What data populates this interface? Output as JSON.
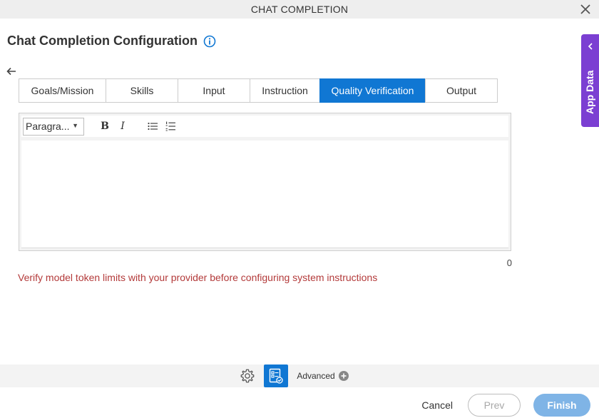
{
  "window": {
    "title": "CHAT COMPLETION"
  },
  "header": {
    "title": "Chat Completion Configuration"
  },
  "tabs": [
    {
      "label": "Goals/Mission",
      "active": false
    },
    {
      "label": "Skills",
      "active": false
    },
    {
      "label": "Input",
      "active": false
    },
    {
      "label": "Instruction",
      "active": false
    },
    {
      "label": "Quality Verification",
      "active": true
    },
    {
      "label": "Output",
      "active": false
    }
  ],
  "editor": {
    "paragraph_format": "Paragra...",
    "bold_label": "B",
    "italic_label": "I",
    "content": "",
    "char_count": "0"
  },
  "warning": {
    "text": "Verify model token limits with your provider before configuring system instructions",
    "color": "#b33a3a"
  },
  "footer": {
    "advanced_label": "Advanced"
  },
  "actions": {
    "cancel": "Cancel",
    "prev": "Prev",
    "finish": "Finish"
  },
  "side_panel": {
    "label": "App Data",
    "color": "#7b3fd2"
  },
  "colors": {
    "accent": "#1077d3",
    "finish_button": "#7fb4e6"
  }
}
